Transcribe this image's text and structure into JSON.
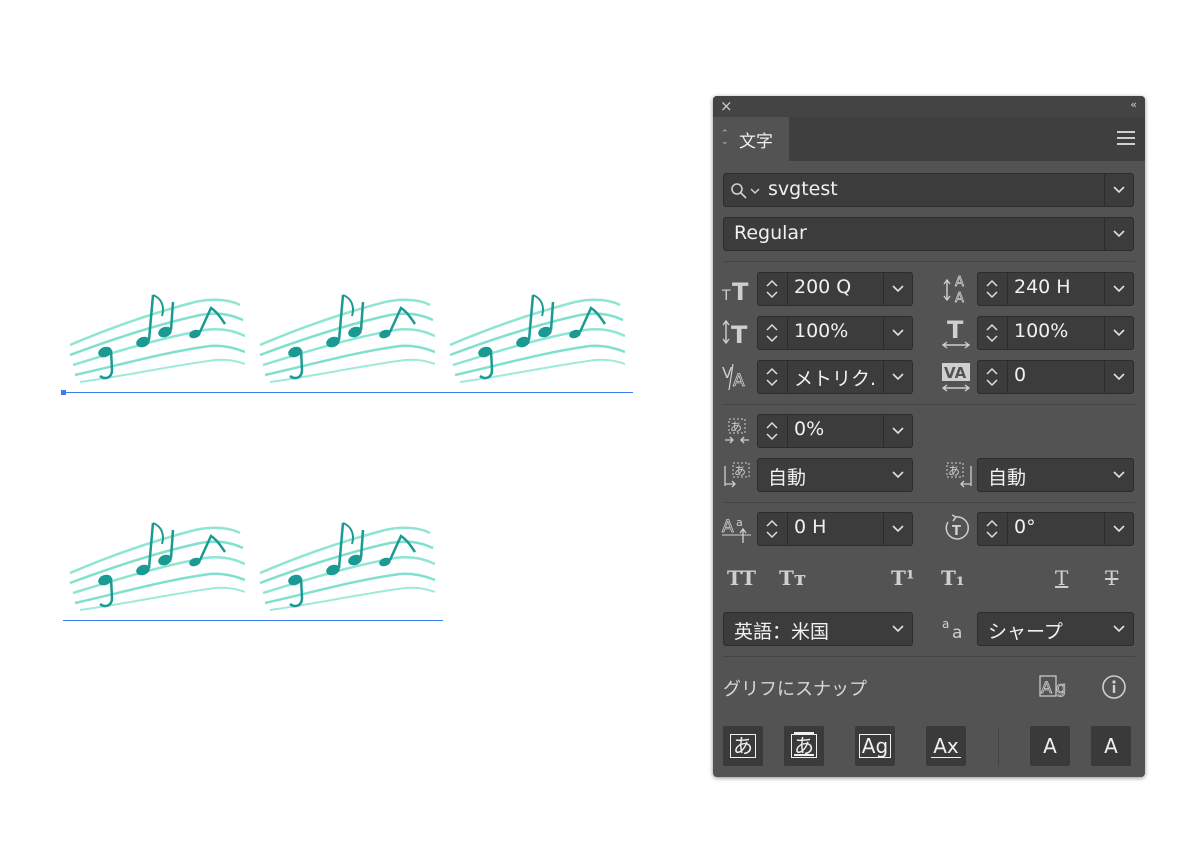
{
  "panel": {
    "title": "文字",
    "font_search": {
      "value": "svgtest"
    },
    "font_style": {
      "value": "Regular"
    },
    "font_size": "200 Q",
    "leading": "240 H",
    "vertical_scale": "100%",
    "horizontal_scale": "100%",
    "kerning": "メトリク.",
    "tracking": "0",
    "tsume": "0%",
    "aki_before": "自動",
    "aki_after": "自動",
    "baseline_shift": "0 H",
    "rotation": "0°",
    "language": "英語：米国",
    "antialias": "シャープ",
    "snap_label": "グリフにスナップ",
    "snap_buttons": [
      "あ",
      "あ",
      "Ag",
      "Ax",
      "A",
      "A"
    ],
    "style_buttons": [
      "TT",
      "Tт",
      "T¹",
      "T₁",
      "T",
      "T"
    ]
  },
  "colors": {
    "panel_bg": "#535353",
    "field_bg": "#3c3c3c",
    "selection_blue": "#3b7cf2",
    "music_dark": "#1a9a92",
    "music_light": "#7fe0cc"
  }
}
